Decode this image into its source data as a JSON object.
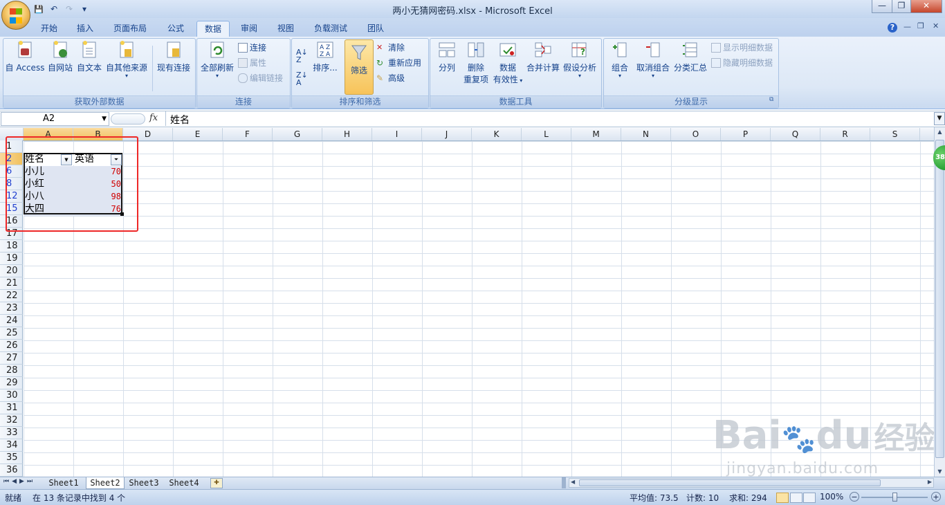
{
  "window": {
    "title": "两小无猜网密码.xlsx - Microsoft Excel",
    "controls": {
      "minimize": "—",
      "restore": "❐",
      "close": "✕"
    }
  },
  "qat": {
    "save": "💾",
    "undo": "↶",
    "redo": "↷",
    "more": "▾"
  },
  "tabs": [
    "开始",
    "插入",
    "页面布局",
    "公式",
    "数据",
    "审阅",
    "视图",
    "负载测试",
    "团队"
  ],
  "active_tab": "数据",
  "ribbon_right": {
    "help": "?",
    "minimize": "—",
    "restore": "❐",
    "close": "✕"
  },
  "ribbon": {
    "get_external": {
      "label": "获取外部数据",
      "buttons": [
        "自 Access",
        "自网站",
        "自文本",
        "自其他来源",
        "现有连接"
      ]
    },
    "connections": {
      "label": "连接",
      "refresh_all": "全部刷新",
      "small": [
        "连接",
        "属性",
        "编辑链接"
      ]
    },
    "sort_filter": {
      "label": "排序和筛选",
      "sort": "排序...",
      "filter": "筛选",
      "small": [
        "清除",
        "重新应用",
        "高级"
      ]
    },
    "data_tools": {
      "label": "数据工具",
      "buttons": [
        "分列",
        "删除\n重复项",
        "数据\n有效性",
        "合并计算",
        "假设分析"
      ],
      "remove_dup_l1": "删除",
      "remove_dup_l2": "重复项",
      "valid_l1": "数据",
      "valid_l2": "有效性"
    },
    "outline": {
      "label": "分级显示",
      "buttons": [
        "组合",
        "取消组合",
        "分类汇总"
      ],
      "small": [
        "显示明细数据",
        "隐藏明细数据"
      ]
    }
  },
  "formula_bar": {
    "name_box": "A2",
    "fx": "fx",
    "content": "姓名"
  },
  "columns": [
    "A",
    "B",
    "D",
    "E",
    "F",
    "G",
    "H",
    "I",
    "J",
    "K",
    "L",
    "M",
    "N",
    "O",
    "P",
    "Q",
    "R",
    "S"
  ],
  "rows": [
    "1",
    "2",
    "6",
    "8",
    "12",
    "15",
    "16",
    "17",
    "18",
    "19",
    "20",
    "21",
    "22",
    "23",
    "24",
    "25",
    "26",
    "27",
    "28",
    "29",
    "30",
    "31",
    "32",
    "33",
    "34",
    "35",
    "36"
  ],
  "table": {
    "headers": [
      "姓名",
      "英语"
    ],
    "rows": [
      [
        "小儿",
        "70"
      ],
      [
        "小红",
        "50"
      ],
      [
        "小八",
        "98"
      ],
      [
        "大四",
        "76"
      ]
    ]
  },
  "sheets": [
    "Sheet1",
    "Sheet2",
    "Sheet3",
    "Sheet4"
  ],
  "active_sheet": "Sheet2",
  "status": {
    "mode": "就绪",
    "filter_msg": "在 13 条记录中找到 4 个",
    "average": "平均值: 73.5",
    "count": "计数: 10",
    "sum": "求和: 294",
    "zoom": "100%"
  },
  "side_badge": "38",
  "watermark": {
    "brand": "Bai",
    "brand2": "du",
    "cn": "经验",
    "url": "jingyan.baidu.com"
  }
}
